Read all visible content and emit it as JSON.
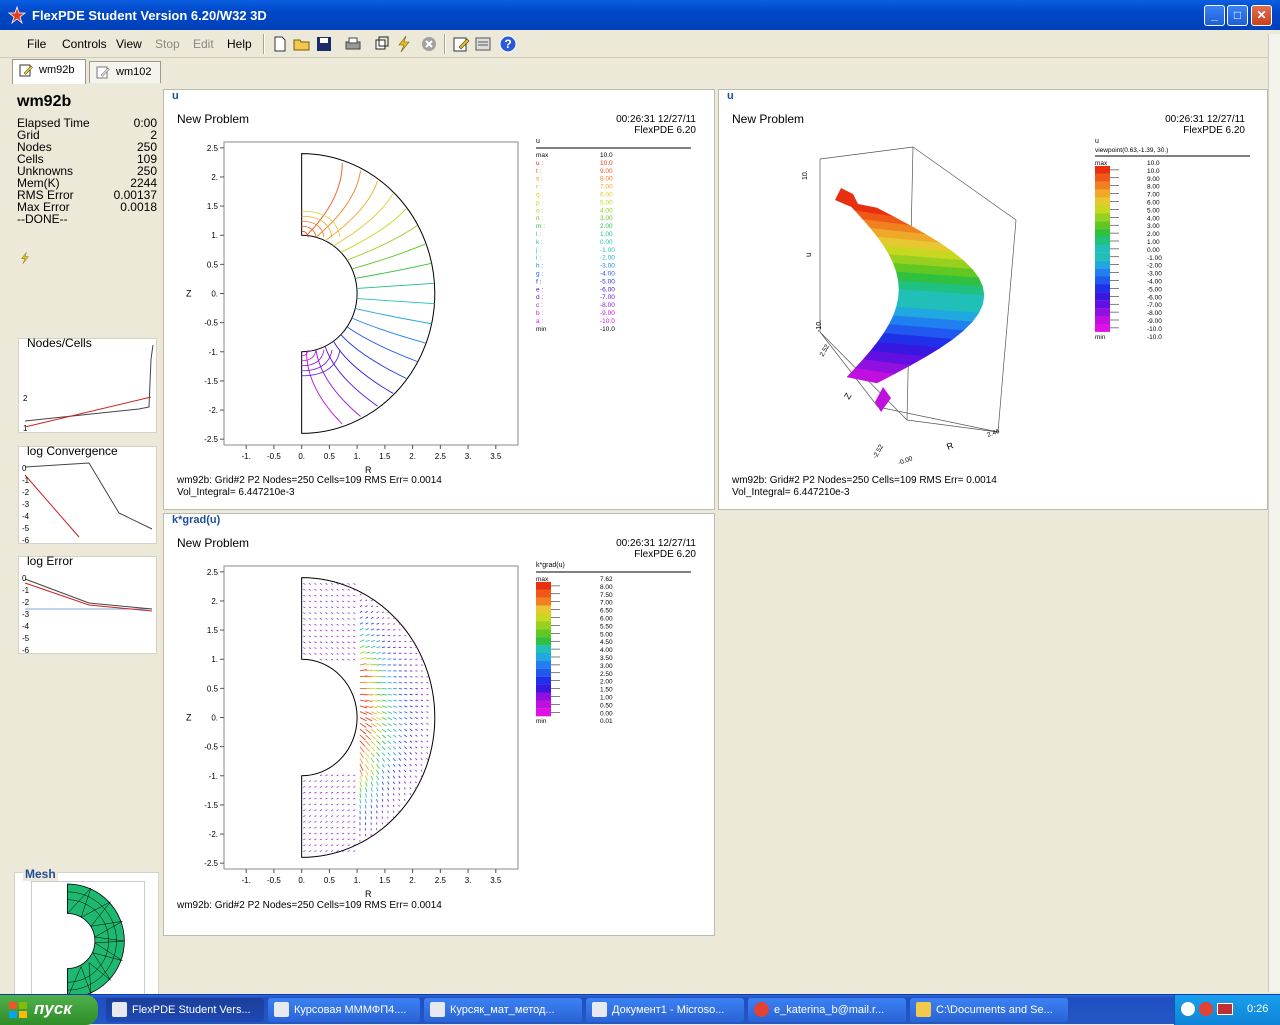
{
  "window": {
    "title": "FlexPDE Student Version 6.20/W32 3D"
  },
  "menu": {
    "items": [
      {
        "label": "File",
        "enabled": true
      },
      {
        "label": "Controls",
        "enabled": true
      },
      {
        "label": "View",
        "enabled": true
      },
      {
        "label": "Stop",
        "enabled": false
      },
      {
        "label": "Edit",
        "enabled": false
      },
      {
        "label": "Help",
        "enabled": true
      }
    ]
  },
  "toolbar": [
    "new-file-icon",
    "open-folder-icon",
    "save-icon",
    "print-icon",
    "windows-icon",
    "run-lightning-icon",
    "stop-icon",
    "edit-icon",
    "preview-icon",
    "help-icon"
  ],
  "tabs": [
    {
      "label": "wm92b",
      "active": true
    },
    {
      "label": "wm102",
      "active": false
    }
  ],
  "status": {
    "name": "wm92b",
    "rows": [
      {
        "label": "Elapsed Time",
        "value": "0:00"
      },
      {
        "label": "Grid",
        "value": "2"
      },
      {
        "label": "Nodes",
        "value": "250"
      },
      {
        "label": "Cells",
        "value": "109"
      },
      {
        "label": "Unknowns",
        "value": "250"
      },
      {
        "label": "Mem(K)",
        "value": "2244"
      },
      {
        "label": "RMS Error",
        "value": "0.00137"
      },
      {
        "label": "Max Error",
        "value": "0.0018"
      }
    ],
    "done": "--DONE--"
  },
  "minis": {
    "nodes": {
      "title": "Nodes/Cells",
      "ticks": [
        "2",
        "1"
      ]
    },
    "conv": {
      "title": "log Convergence",
      "ticks": [
        "0",
        "-1",
        "-2",
        "-3",
        "-4",
        "-5",
        "-6"
      ]
    },
    "err": {
      "title": "log Error",
      "ticks": [
        "0",
        "-1",
        "-2",
        "-3",
        "-4",
        "-5",
        "-6"
      ]
    }
  },
  "mesh": {
    "title": "Mesh"
  },
  "panels": {
    "u_contour": {
      "title": "u",
      "plot_title": "New Problem",
      "stamp1": "00:26:31 12/27/11",
      "stamp2": "FlexPDE 6.20",
      "legend_head": "u",
      "info1": "wm92b:  Grid#2  P2  Nodes=250 Cells=109 RMS Err= 0.0014",
      "info2": "Vol_Integral=  6.447210e-3",
      "xlabel": "R",
      "ylabel": "Z",
      "xticks": [
        "-1.",
        "-0.5",
        "0.",
        "0.5",
        "1.",
        "1.5",
        "2.",
        "2.5",
        "3.",
        "3.5"
      ],
      "yticks": [
        "2.5",
        "2.",
        "1.5",
        "1.",
        "0.5",
        "0.",
        "-0.5",
        "-1.",
        "-1.5",
        "-2.",
        "-2.5"
      ],
      "legend": [
        {
          "l": "max",
          "v": "10.0"
        },
        {
          "l": "u :",
          "v": "10.0"
        },
        {
          "l": "t :",
          "v": "9.00"
        },
        {
          "l": "s :",
          "v": "8.00"
        },
        {
          "l": "r :",
          "v": "7.00"
        },
        {
          "l": "q :",
          "v": "6.00"
        },
        {
          "l": "p :",
          "v": "5.00"
        },
        {
          "l": "o :",
          "v": "4.00"
        },
        {
          "l": "n :",
          "v": "3.00"
        },
        {
          "l": "m :",
          "v": "2.00"
        },
        {
          "l": "l :",
          "v": "1.00"
        },
        {
          "l": "k :",
          "v": "0.00"
        },
        {
          "l": "j :",
          "v": "-1.00"
        },
        {
          "l": "i :",
          "v": "-2.00"
        },
        {
          "l": "h :",
          "v": "-3.00"
        },
        {
          "l": "g :",
          "v": "-4.00"
        },
        {
          "l": "f :",
          "v": "-5.00"
        },
        {
          "l": "e :",
          "v": "-6.00"
        },
        {
          "l": "d :",
          "v": "-7.00"
        },
        {
          "l": "c :",
          "v": "-8.00"
        },
        {
          "l": "b :",
          "v": "-9.00"
        },
        {
          "l": "a :",
          "v": "-10.0"
        },
        {
          "l": "min",
          "v": "-10.0"
        }
      ]
    },
    "u_surface": {
      "title": "u",
      "plot_title": "New Problem",
      "stamp1": "00:26:31 12/27/11",
      "stamp2": "FlexPDE 6.20",
      "legend_head": "u",
      "viewpoint": "viewpoint(0.63,-1.39, 30.)",
      "info1": "wm92b:  Grid#2  P2  Nodes=250 Cells=109 RMS Err= 0.0014",
      "info2": "Vol_Integral=  6.447210e-3",
      "axis_u": "u",
      "axis_z": "Z",
      "axis_r": "R",
      "t_u_top": "10.",
      "t_u_bot": "-10.",
      "t_z1": "2.52",
      "t_z2": "-2.52",
      "t_r1": "-0.00",
      "t_r2": "2.46",
      "legend": [
        {
          "l": "max",
          "v": "10.0"
        },
        {
          "l": "",
          "v": "10.0"
        },
        {
          "l": "",
          "v": "9.00"
        },
        {
          "l": "",
          "v": "8.00"
        },
        {
          "l": "",
          "v": "7.00"
        },
        {
          "l": "",
          "v": "6.00"
        },
        {
          "l": "",
          "v": "5.00"
        },
        {
          "l": "",
          "v": "4.00"
        },
        {
          "l": "",
          "v": "3.00"
        },
        {
          "l": "",
          "v": "2.00"
        },
        {
          "l": "",
          "v": "1.00"
        },
        {
          "l": "",
          "v": "0.00"
        },
        {
          "l": "",
          "v": "-1.00"
        },
        {
          "l": "",
          "v": "-2.00"
        },
        {
          "l": "",
          "v": "-3.00"
        },
        {
          "l": "",
          "v": "-4.00"
        },
        {
          "l": "",
          "v": "-5.00"
        },
        {
          "l": "",
          "v": "-6.00"
        },
        {
          "l": "",
          "v": "-7.00"
        },
        {
          "l": "",
          "v": "-8.00"
        },
        {
          "l": "",
          "v": "-9.00"
        },
        {
          "l": "",
          "v": "-10.0"
        },
        {
          "l": "min",
          "v": "-10.0"
        }
      ]
    },
    "kgrad": {
      "title": "k*grad(u)",
      "plot_title": "New Problem",
      "stamp1": "00:26:31 12/27/11",
      "stamp2": "FlexPDE 6.20",
      "legend_head": "k*grad(u)",
      "info1": "wm92b:  Grid#2  P2  Nodes=250 Cells=109 RMS Err= 0.0014",
      "xlabel": "R",
      "ylabel": "Z",
      "xticks": [
        "-1.",
        "-0.5",
        "0.",
        "0.5",
        "1.",
        "1.5",
        "2.",
        "2.5",
        "3.",
        "3.5"
      ],
      "yticks": [
        "2.5",
        "2.",
        "1.5",
        "1.",
        "0.5",
        "0.",
        "-0.5",
        "-1.",
        "-1.5",
        "-2.",
        "-2.5"
      ],
      "legend": [
        {
          "l": "max",
          "v": "7.62"
        },
        {
          "l": "",
          "v": "8.00"
        },
        {
          "l": "",
          "v": "7.50"
        },
        {
          "l": "",
          "v": "7.00"
        },
        {
          "l": "",
          "v": "6.50"
        },
        {
          "l": "",
          "v": "6.00"
        },
        {
          "l": "",
          "v": "5.50"
        },
        {
          "l": "",
          "v": "5.00"
        },
        {
          "l": "",
          "v": "4.50"
        },
        {
          "l": "",
          "v": "4.00"
        },
        {
          "l": "",
          "v": "3.50"
        },
        {
          "l": "",
          "v": "3.00"
        },
        {
          "l": "",
          "v": "2.50"
        },
        {
          "l": "",
          "v": "2.00"
        },
        {
          "l": "",
          "v": "1.50"
        },
        {
          "l": "",
          "v": "1.00"
        },
        {
          "l": "",
          "v": "0.50"
        },
        {
          "l": "",
          "v": "0.00"
        },
        {
          "l": "min",
          "v": "0.01"
        }
      ]
    }
  },
  "taskbar": {
    "start": "пуск",
    "tasks": [
      {
        "label": "FlexPDE Student Vers...",
        "active": true
      },
      {
        "label": "Курсовая МММФП4....",
        "active": false
      },
      {
        "label": "Курсяк_мат_метод...",
        "active": false
      },
      {
        "label": "Документ1 - Microso...",
        "active": false
      },
      {
        "label": "e_katerina_b@mail.r...",
        "active": false
      },
      {
        "label": "C:\\Documents and Se...",
        "active": false
      }
    ],
    "clock": "0:26"
  }
}
